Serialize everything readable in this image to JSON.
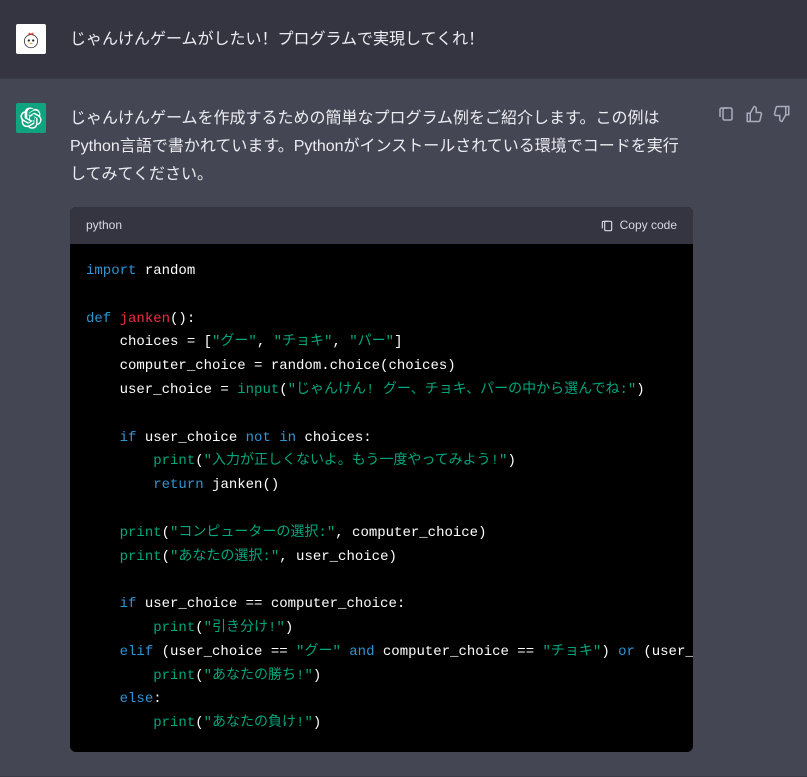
{
  "user_message": "じゃんけんゲームがしたい！プログラムで実現してくれ！",
  "assistant_intro": "じゃんけんゲームを作成するための簡単なプログラム例をご紹介します。この例はPython言語で書かれています。Pythonがインストールされている環境でコードを実行してみてください。",
  "code_lang": "python",
  "copy_label": "Copy code",
  "code": {
    "import": "import",
    "random": " random",
    "def": "def",
    "janken": " janken",
    "def_tail": "():",
    "choices_line": "    choices = [",
    "s_gu": "\"グー\"",
    "comma": ", ",
    "s_choki": "\"チョキ\"",
    "s_pa": "\"パー\"",
    "choices_end": "]",
    "comp_line": "    computer_choice = random.choice(choices)",
    "user_line_a": "    user_choice = ",
    "input": "input",
    "user_line_b": "(",
    "s_prompt": "\"じゃんけん! グー、チョキ、パーの中から選んでね:\"",
    "user_line_c": ")",
    "if1_a": "    ",
    "if": "if",
    "if1_b": " user_choice ",
    "not": "not",
    "sp": " ",
    "in": "in",
    "if1_c": " choices:",
    "print": "print",
    "pr_open": "(",
    "pr_close": ")",
    "indent2": "        ",
    "s_badinput": "\"入力が正しくないよ。もう一度やってみよう!\"",
    "return": "return",
    "ret_tail": " janken()",
    "pr_comp_a": "    ",
    "s_compsel": "\"コンピューターの選択:\"",
    "pr_comp_b": ", computer_choice)",
    "s_yoursel": "\"あなたの選択:\"",
    "pr_user_b": ", user_choice)",
    "if2_b": " user_choice == computer_choice:",
    "s_draw": "\"引き分け!\"",
    "elif": "elif",
    "elif_b": " (user_choice == ",
    "and": "and",
    "elif_c": " computer_choice == ",
    "elif_d": ") ",
    "or": "or",
    "elif_e": " (user_choic",
    "s_win": "\"あなたの勝ち!\"",
    "else": "else",
    "colon": ":",
    "s_lose": "\"あなたの負け!\""
  }
}
